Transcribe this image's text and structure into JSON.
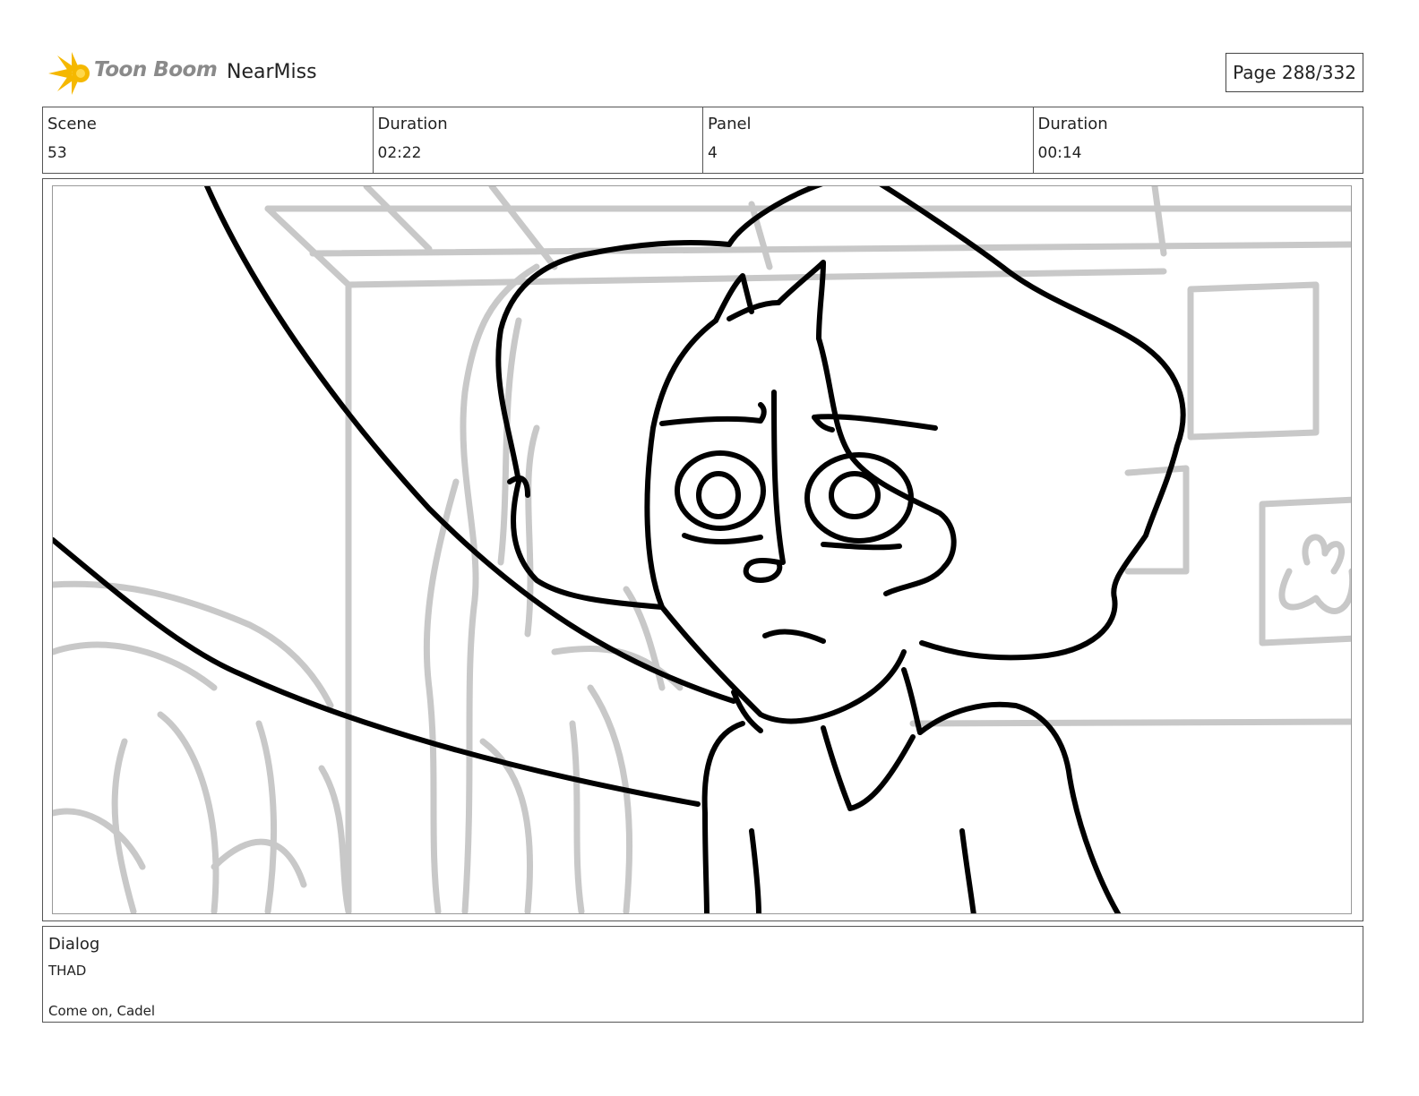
{
  "header": {
    "logo_text": "Toon Boom",
    "project_name": "NearMiss",
    "page_label": "Page 288/332"
  },
  "info": [
    {
      "label": "Scene",
      "value": "53"
    },
    {
      "label": "Duration",
      "value": "02:22"
    },
    {
      "label": "Panel",
      "value": "4"
    },
    {
      "label": "Duration",
      "value": "00:14"
    }
  ],
  "panel": {
    "image_kind": "storyboard sketch",
    "line_color": "#000000",
    "background_sketch_color": "#c8c8c8"
  },
  "dialog": {
    "label": "Dialog",
    "speaker": "THAD",
    "line": "Come on, Cadel"
  },
  "colors": {
    "logo_star": "#f5b800",
    "logo_text": "#8a8a8a",
    "border": "#555555"
  }
}
